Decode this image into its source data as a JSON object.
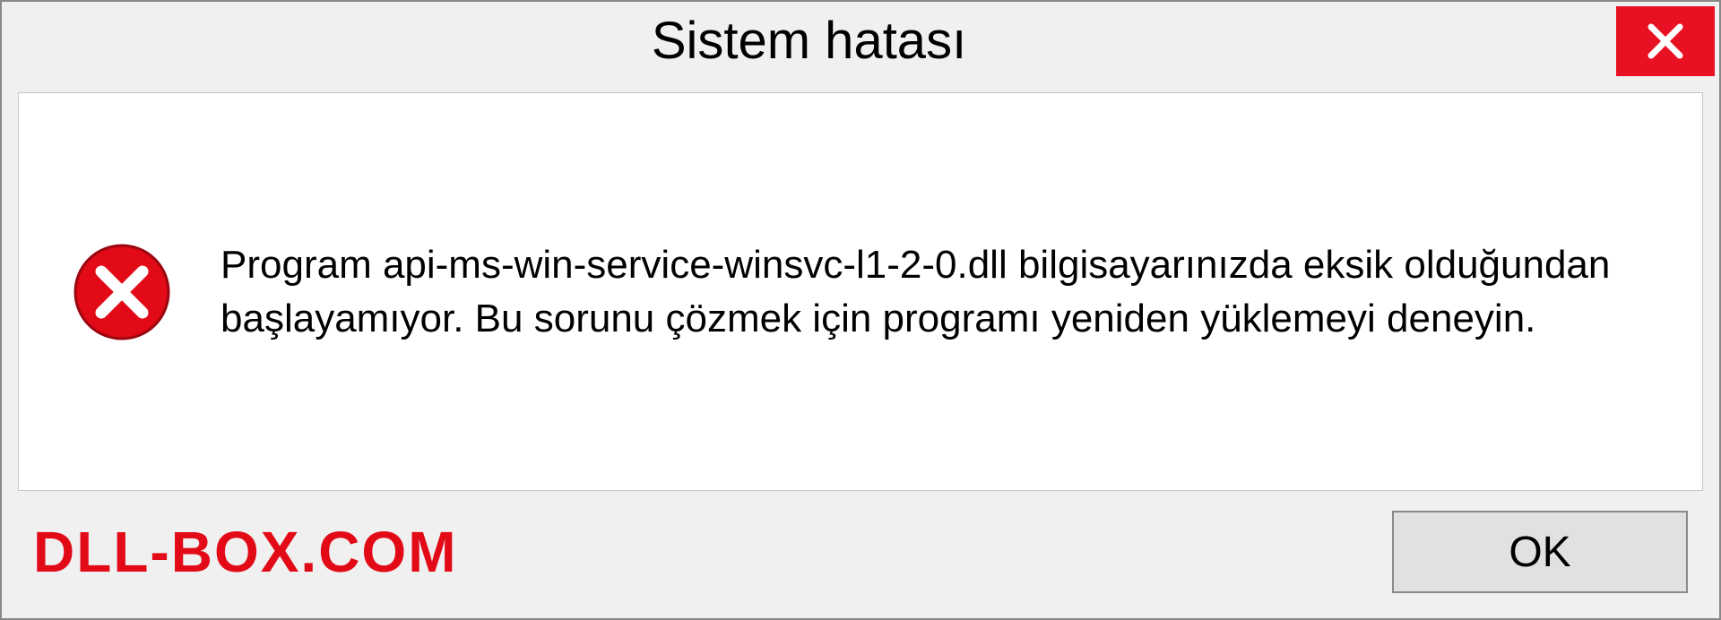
{
  "dialog": {
    "title": "Sistem hatası",
    "message": "Program api-ms-win-service-winsvc-l1-2-0.dll bilgisayarınızda eksik olduğundan başlayamıyor. Bu sorunu çözmek için programı yeniden yüklemeyi deneyin.",
    "ok_label": "OK"
  },
  "watermark": "DLL-BOX.COM",
  "colors": {
    "close_bg": "#e81123",
    "error_red": "#e20a17"
  }
}
